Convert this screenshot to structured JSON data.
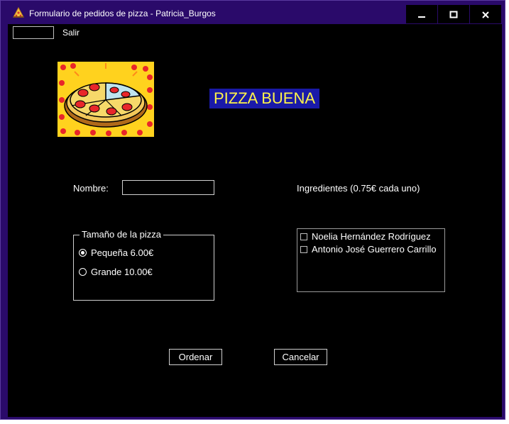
{
  "window": {
    "title": "Formulario de pedidos de pizza - Patricia_Burgos",
    "controls": {
      "minimize": "🗕",
      "maximize": "☐",
      "close": "✕"
    }
  },
  "menu": {
    "item_salir": "Salir"
  },
  "brand": {
    "text": "PIZZA BUENA"
  },
  "form": {
    "name_label": "Nombre:",
    "name_value": "",
    "ingredients_label": "Ingredientes (0.75€ cada uno)",
    "size_group": {
      "legend": "Tamaño de la pizza",
      "options": [
        {
          "label": "Pequeña 6.00€",
          "checked": true
        },
        {
          "label": "Grande 10.00€",
          "checked": false
        }
      ]
    },
    "ingredients": [
      {
        "label": "Noelia Hernández Rodríguez",
        "checked": false
      },
      {
        "label": "Antonio José Guerrero Carrillo",
        "checked": false
      }
    ],
    "order_button": "Ordenar",
    "cancel_button": "Cancelar"
  },
  "colors": {
    "titlebar": "#2a0a6a",
    "client_bg": "#000000",
    "brand_bg": "#1a1aa8",
    "brand_text": "#fff44a"
  },
  "icons": {
    "app": "pizza-slice-icon",
    "logo": "pizza-logo"
  }
}
